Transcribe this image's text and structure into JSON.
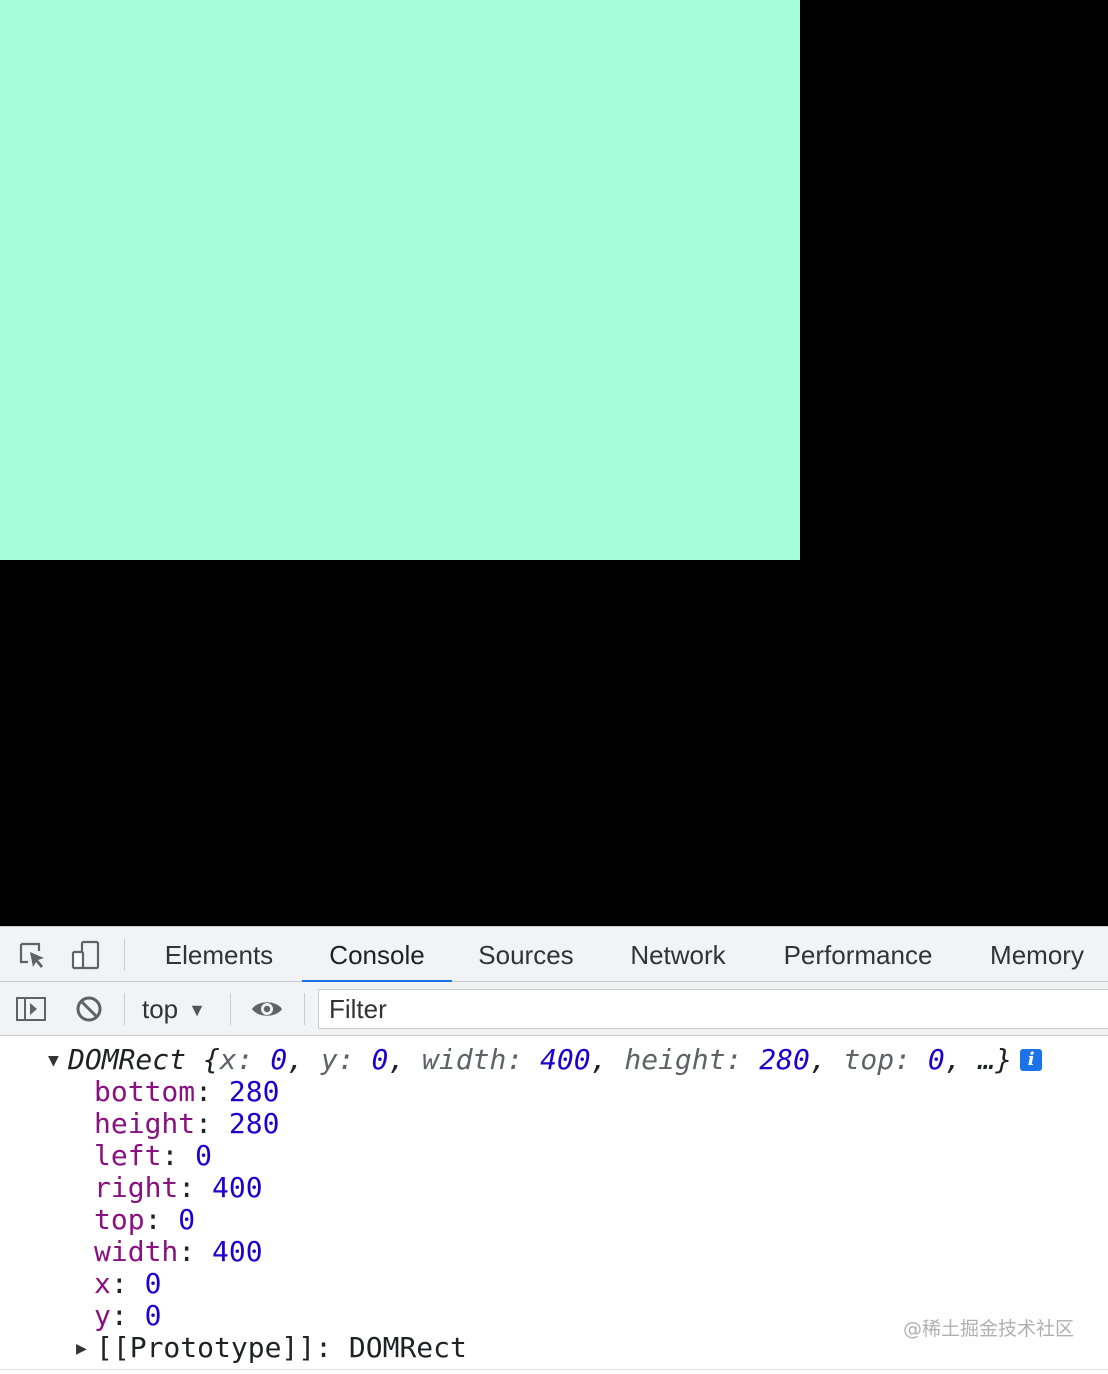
{
  "page": {
    "box_color": "#a5fcd8",
    "background_color": "#000000"
  },
  "devtools": {
    "toolbar_icons": [
      "inspect-element-icon",
      "device-toolbar-icon"
    ],
    "tabs": [
      {
        "label": "Elements",
        "active": false
      },
      {
        "label": "Console",
        "active": true
      },
      {
        "label": "Sources",
        "active": false
      },
      {
        "label": "Network",
        "active": false
      },
      {
        "label": "Performance",
        "active": false
      },
      {
        "label": "Memory",
        "active": false
      }
    ],
    "accent_color": "#1a73e8"
  },
  "console_toolbar": {
    "icons": [
      "sidebar-toggle-icon",
      "clear-console-icon",
      "live-expression-eye-icon"
    ],
    "context": "top",
    "context_arrow": "▼",
    "filter_placeholder": "Filter"
  },
  "console_output": {
    "summary": {
      "type": "DOMRect",
      "preview": [
        {
          "key": "x",
          "value": "0"
        },
        {
          "key": "y",
          "value": "0"
        },
        {
          "key": "width",
          "value": "400"
        },
        {
          "key": "height",
          "value": "280"
        },
        {
          "key": "top",
          "value": "0"
        }
      ],
      "more": "…",
      "info_badge": "i"
    },
    "properties": [
      {
        "key": "bottom",
        "value": "280"
      },
      {
        "key": "height",
        "value": "280"
      },
      {
        "key": "left",
        "value": "0"
      },
      {
        "key": "right",
        "value": "400"
      },
      {
        "key": "top",
        "value": "0"
      },
      {
        "key": "width",
        "value": "400"
      },
      {
        "key": "x",
        "value": "0"
      },
      {
        "key": "y",
        "value": "0"
      }
    ],
    "prototype": {
      "key": "[[Prototype]]",
      "value": "DOMRect"
    }
  },
  "watermark": "@稀土掘金技术社区"
}
